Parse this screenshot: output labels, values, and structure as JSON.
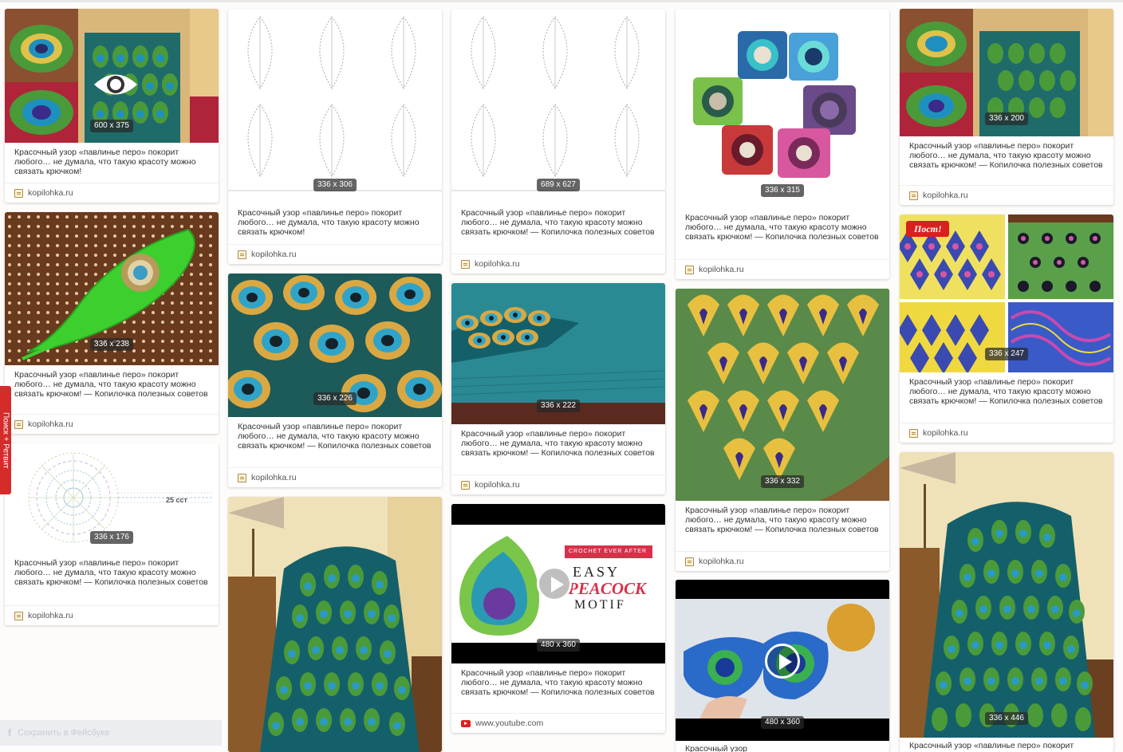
{
  "caption_short": "Красочный узор «павлинье перо» покорит любого… не думала, что такую красоту можно связать крючком!",
  "caption_long": "Красочный узор «павлинье перо» покорит любого… не думала, что такую красоту можно связать крючком! — Копилочка полезных советов",
  "source_kopilka": "kopilohka.ru",
  "source_youtube": "www.youtube.com",
  "sizes": {
    "c1": "600 x 375",
    "c2": "336 x 238",
    "c3": "336 x 176",
    "c4": "336 x 306",
    "c5": "336 x 226",
    "c7": "689 x 627",
    "c8": "336 x 222",
    "c9": "480 x 360",
    "c10": "336 x 315",
    "c11": "336 x 332",
    "c12": "480 x 360",
    "c13": "336 x 200",
    "c14": "336 x 247",
    "c15": "336 x 446"
  },
  "post_badge": "Пост!",
  "video_title": {
    "line1": "CROCHET EVER AFTER",
    "line2": "EASY",
    "line3": "PEACOCK",
    "line4": "MOTIF"
  },
  "chart_label": "25 сст",
  "side_tab": "Поиск + Ретвит",
  "facebook_save": "Сохранить в Фейсбуке",
  "partial_caption": "Красочный узор «павлинье перо» покорит",
  "partial_caption2": "Красочный узор"
}
